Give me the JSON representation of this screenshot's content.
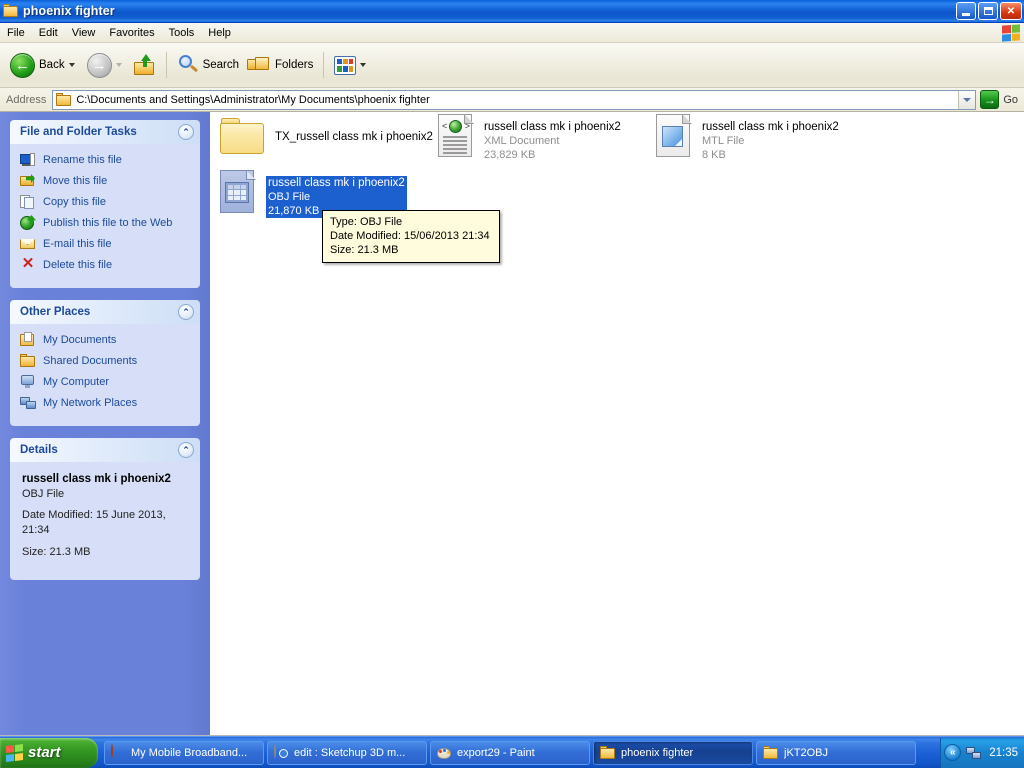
{
  "window": {
    "title": "phoenix fighter",
    "icon": "folder-icon",
    "minimize_label": "Minimize",
    "maximize_label": "Maximize",
    "close_label": "Close"
  },
  "menubar": {
    "items": [
      {
        "label": "File"
      },
      {
        "label": "Edit"
      },
      {
        "label": "View"
      },
      {
        "label": "Favorites"
      },
      {
        "label": "Tools"
      },
      {
        "label": "Help"
      }
    ]
  },
  "toolbar": {
    "back_label": "Back",
    "forward_label": "",
    "up_label": "",
    "search_label": "Search",
    "folders_label": "Folders",
    "views_label": ""
  },
  "address": {
    "label": "Address",
    "value": "C:\\Documents and Settings\\Administrator\\My Documents\\phoenix fighter",
    "go_label": "Go"
  },
  "sidebar": {
    "panels": [
      {
        "title": "File and Folder Tasks",
        "items": [
          {
            "label": "Rename this file",
            "icon": "rename-icon"
          },
          {
            "label": "Move this file",
            "icon": "move-icon"
          },
          {
            "label": "Copy this file",
            "icon": "copy-icon"
          },
          {
            "label": "Publish this file to the Web",
            "icon": "publish-icon"
          },
          {
            "label": "E-mail this file",
            "icon": "email-icon"
          },
          {
            "label": "Delete this file",
            "icon": "delete-icon"
          }
        ]
      },
      {
        "title": "Other Places",
        "items": [
          {
            "label": "My Documents",
            "icon": "my-documents-icon"
          },
          {
            "label": "Shared Documents",
            "icon": "shared-documents-icon"
          },
          {
            "label": "My Computer",
            "icon": "my-computer-icon"
          },
          {
            "label": "My Network Places",
            "icon": "my-network-places-icon"
          }
        ]
      }
    ],
    "details": {
      "title": "Details",
      "name": "russell class mk i phoenix2",
      "type": "OBJ File",
      "date_modified": "Date Modified: 15 June 2013, 21:34",
      "size": "Size: 21.3 MB"
    }
  },
  "files": [
    {
      "name": "TX_russell class mk i phoenix2",
      "type": "",
      "size": "",
      "icon": "folder-icon",
      "selected": false
    },
    {
      "name": "russell class mk i phoenix2",
      "type": "XML Document",
      "size": "23,829 KB",
      "icon": "xml-document-icon",
      "selected": false
    },
    {
      "name": "russell class mk i phoenix2",
      "type": "MTL File",
      "size": "8 KB",
      "icon": "mtl-file-icon",
      "selected": false
    },
    {
      "name": "russell class mk i phoenix2",
      "type": "OBJ File",
      "size": "21,870 KB",
      "icon": "obj-file-icon",
      "selected": true
    }
  ],
  "tooltip": {
    "type_line": "Type: OBJ File",
    "date_line": "Date Modified: 15/06/2013 21:34",
    "size_line": "Size: 21.3 MB"
  },
  "taskbar": {
    "start_label": "start",
    "buttons": [
      {
        "label": "My Mobile Broadband...",
        "icon": "firefox-icon",
        "active": false
      },
      {
        "label": "edit : Sketchup 3D m...",
        "icon": "chrome-icon",
        "active": false
      },
      {
        "label": "export29 - Paint",
        "icon": "paint-icon",
        "active": false
      },
      {
        "label": "phoenix fighter",
        "icon": "folder-icon",
        "active": true
      },
      {
        "label": "jKT2OBJ",
        "icon": "folder-icon",
        "active": false
      }
    ],
    "tray": {
      "chevron": "«",
      "network_icon": "network-icon",
      "time": "21:35"
    }
  },
  "colors": {
    "titlebar_blue": "#1463d8",
    "sidebar_blue": "#6a81da",
    "panel_body": "#d6dff7",
    "selection_blue": "#1c5fcf",
    "tooltip_bg": "#fffbdd",
    "link_blue": "#1c4a99",
    "start_green": "#2f8f1f"
  }
}
